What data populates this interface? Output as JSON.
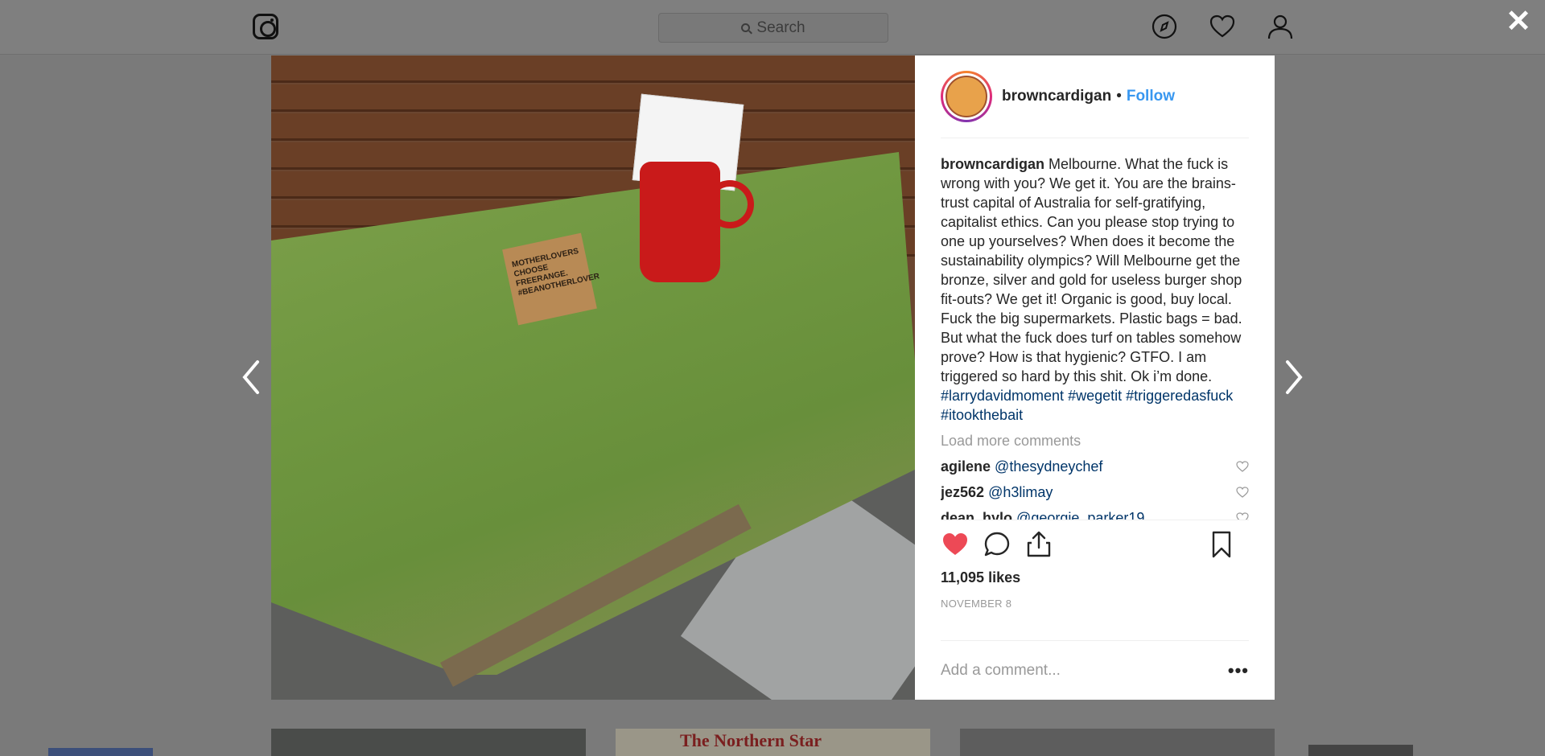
{
  "header": {
    "logo_icon": "instagram-icon",
    "search_placeholder": "Search",
    "nav_icons": [
      "compass-icon",
      "heart-icon",
      "user-icon"
    ]
  },
  "modal": {
    "close_label": "✕",
    "post": {
      "username": "browncardigan",
      "separator": "•",
      "follow_label": "Follow",
      "caption_user": "browncardigan",
      "caption_text": " Melbourne. What the fuck is wrong with you? We get it. You are the brains-trust capital of Australia for self-gratifying, capitalist ethics. Can you please stop trying to one up yourselves? When does it become the sustainability olympics? Will Melbourne get the bronze, silver and gold for useless burger shop fit-outs? We get it! Organic is good, buy local. Fuck the big supermarkets. Plastic bags = bad. But what the fuck does turf on tables somehow prove? How is that hygienic? GTFO. I am triggered so hard by this shit. Ok i’m done.",
      "hashtags": [
        "#larrydavidmoment",
        "#wegetit",
        "#triggeredasfuck",
        "#itookthebait"
      ],
      "load_more_label": "Load more comments",
      "comments": [
        {
          "user": "agilene",
          "text": "@thesydneychef"
        },
        {
          "user": "jez562",
          "text": "@h3limay"
        },
        {
          "user": "dean_hylo",
          "text": "@georgie_parker19"
        }
      ],
      "likes": "11,095 likes",
      "date": "NOVEMBER 8",
      "add_comment_placeholder": "Add a comment...",
      "more_label": "•••",
      "liked": true,
      "sign_text": "MOTHERLOVERS CHOOSE FREERANGE. #BEANOTHERLOVER"
    }
  },
  "thumbnails": [
    {
      "label": ""
    },
    {
      "label": "The Northern Star"
    },
    {
      "label": ""
    }
  ],
  "colors": {
    "follow": "#3897f0",
    "like_active": "#ed4956",
    "hashtag": "#003569"
  }
}
